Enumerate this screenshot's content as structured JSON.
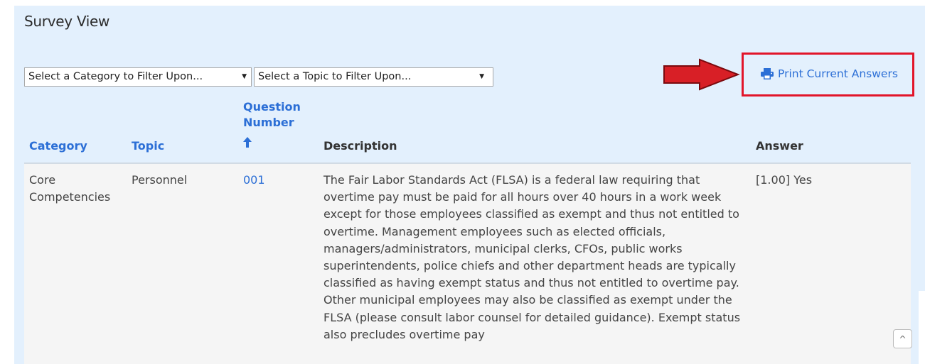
{
  "page": {
    "title": "Survey View"
  },
  "filters": {
    "category": {
      "selected": "Select a Category to Filter Upon...",
      "arrow": "▼"
    },
    "topic": {
      "selected": "Select a Topic to Filter Upon...",
      "arrow": "▼"
    }
  },
  "actions": {
    "print_label": "Print Current Answers",
    "print_icon": "print-icon",
    "annotation_color": "#e2152a",
    "link_color": "#2c6fd6"
  },
  "table": {
    "headers": {
      "category": "Category",
      "topic": "Topic",
      "question_line1": "Question",
      "question_line2": "Number",
      "description": "Description",
      "answer": "Answer"
    },
    "sort": {
      "column": "question_number",
      "direction": "ascending",
      "icon": "arrow-up-icon"
    },
    "rows": [
      {
        "category_line1": "Core",
        "category_line2": "Competencies",
        "topic": "Personnel",
        "question_number": "001",
        "description": "The Fair Labor Standards Act (FLSA) is a federal law requiring that overtime pay must be paid for all hours over 40 hours in a work week except for those employees classified as exempt and thus not entitled to overtime. Management employees such as elected officials, managers/administrators, municipal clerks, CFOs, public works superintendents, police chiefs and other department heads are typically classified as having exempt status and thus not entitled to overtime pay. Other municipal employees may also be classified as exempt under the FLSA (please consult labor counsel for detailed guidance). Exempt status also precludes overtime pay",
        "answer": "[1.00] Yes"
      }
    ]
  },
  "scroll_top": {
    "label": "^"
  }
}
